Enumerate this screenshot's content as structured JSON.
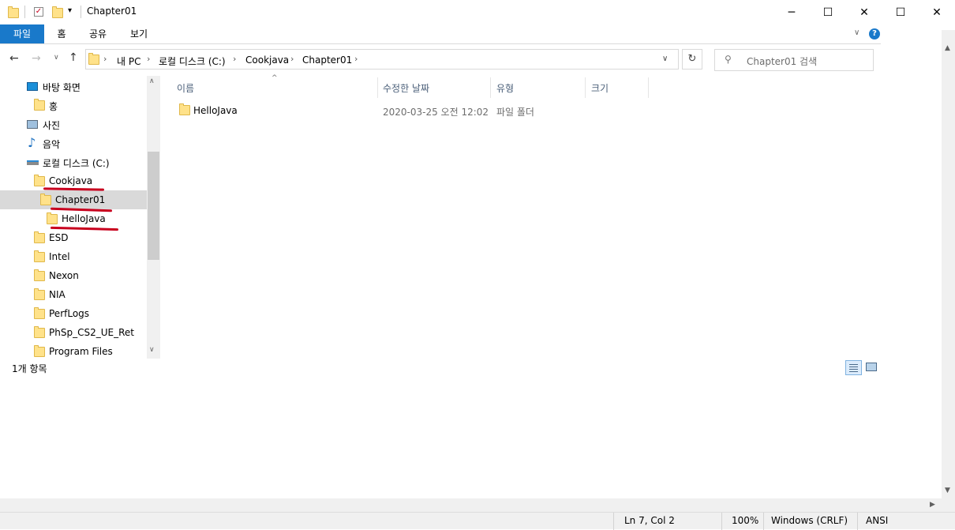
{
  "window": {
    "title": "Chapter01"
  },
  "ribbon": {
    "tabs": [
      "파일",
      "홈",
      "공유",
      "보기"
    ]
  },
  "address": {
    "crumbs": [
      "내 PC",
      "로컬 디스크 (C:)",
      "Cookjava",
      "Chapter01"
    ]
  },
  "search": {
    "placeholder": "Chapter01 검색"
  },
  "nav": {
    "items": [
      {
        "label": "바탕 화면",
        "icon": "desktop-icon"
      },
      {
        "label": "홍",
        "icon": "folder-icon"
      },
      {
        "label": "사진",
        "icon": "pictures-icon"
      },
      {
        "label": "음악",
        "icon": "music-icon"
      },
      {
        "label": "로컬 디스크 (C:)",
        "icon": "drive-icon"
      },
      {
        "label": "Cookjava",
        "icon": "folder-icon"
      },
      {
        "label": "Chapter01",
        "icon": "folder-icon"
      },
      {
        "label": "HelloJava",
        "icon": "folder-icon"
      },
      {
        "label": "ESD",
        "icon": "folder-icon"
      },
      {
        "label": "Intel",
        "icon": "folder-icon"
      },
      {
        "label": "Nexon",
        "icon": "folder-icon"
      },
      {
        "label": "NIA",
        "icon": "folder-icon"
      },
      {
        "label": "PerfLogs",
        "icon": "folder-icon"
      },
      {
        "label": "PhSp_CS2_UE_Ret",
        "icon": "folder-icon"
      },
      {
        "label": "Program Files",
        "icon": "folder-icon"
      }
    ]
  },
  "columns": {
    "name": "이름",
    "modified": "수정한 날짜",
    "type": "유형",
    "size": "크기"
  },
  "files": [
    {
      "name": "HelloJava",
      "modified": "2020-03-25 오전 12:02",
      "type": "파일 폴더",
      "size": ""
    }
  ],
  "status": {
    "count": "1개 항목"
  },
  "notepad": {
    "position": "Ln 7, Col 2",
    "zoom": "100%",
    "eol": "Windows (CRLF)",
    "encoding": "ANSI"
  },
  "colors": {
    "accent": "#1979ca",
    "annotation": "#c8001e",
    "selected": "#d9d9d9"
  }
}
